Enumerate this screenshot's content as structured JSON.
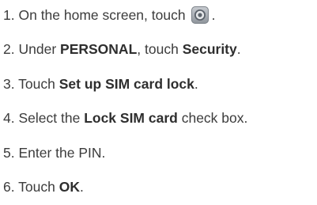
{
  "steps": [
    {
      "num": "1.",
      "pre": "On the home screen, touch",
      "icon": "settings-gear-icon",
      "post": "."
    },
    {
      "num": "2.",
      "pre": "Under",
      "bold1": "PERSONAL",
      "mid": ", touch",
      "bold2": "Security",
      "post": "."
    },
    {
      "num": "3.",
      "pre": "Touch",
      "bold1": "Set up SIM card lock",
      "post": "."
    },
    {
      "num": "4.",
      "pre": "Select the",
      "bold1": "Lock SIM card",
      "post": "check box."
    },
    {
      "num": "5.",
      "pre": "Enter the PIN."
    },
    {
      "num": "6.",
      "pre": "Touch",
      "bold1": "OK",
      "post": "."
    }
  ]
}
